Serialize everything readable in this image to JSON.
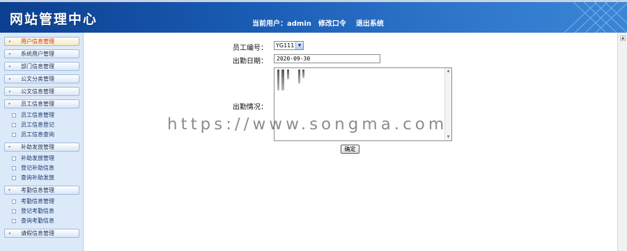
{
  "header": {
    "logo": "网站管理中心",
    "current_user_label": "当前用户：admin",
    "change_password": "修改口令",
    "logout": "退出系统"
  },
  "sidebar": {
    "sections": [
      {
        "label": "用户信息管理",
        "active": true
      },
      {
        "label": "系统用户管理"
      },
      {
        "label": "部门信息管理"
      },
      {
        "label": "公文分类管理"
      },
      {
        "label": "公文信息管理"
      },
      {
        "label": "员工信息管理",
        "items": [
          "员工信息管理",
          "员工信息登记",
          "员工信息查询"
        ]
      },
      {
        "label": "补助发放管理",
        "items": [
          "补助发放管理",
          "登记补助信息",
          "查询补助发放"
        ]
      },
      {
        "label": "考勤信息管理",
        "items": [
          "考勤信息管理",
          "登记考勤信息",
          "查询考勤信息"
        ]
      },
      {
        "label": "请假信息管理"
      }
    ]
  },
  "form": {
    "employee_no_label": "员工编号：",
    "employee_no_value": "YG111",
    "date_label": "出勤日期：",
    "date_value": "2020-09-30",
    "status_label": "出勤情况：",
    "submit": "确定"
  },
  "watermark": "https://www.songma.com",
  "colors": {
    "header": "#1a5cb4",
    "sidebar": "#dce9f8",
    "active_menu_text": "#c53a16"
  }
}
